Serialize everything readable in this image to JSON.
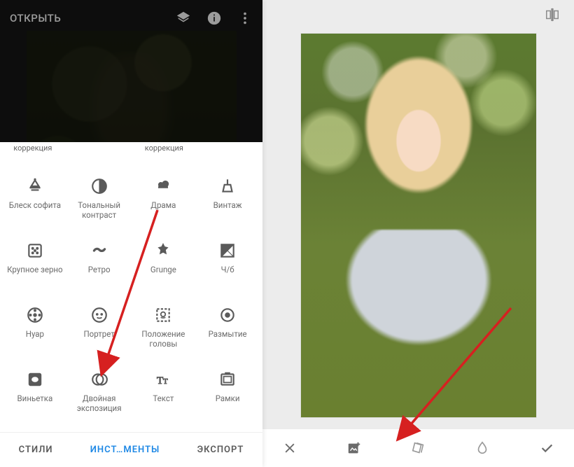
{
  "left": {
    "open_label": "ОТКРЫТЬ",
    "peek": [
      "коррекция",
      "",
      "коррекция",
      ""
    ],
    "tools": [
      {
        "id": "glamour-glow",
        "label": "Блеск софита"
      },
      {
        "id": "tonal-contrast",
        "label": "Тональный контраст"
      },
      {
        "id": "drama",
        "label": "Драма"
      },
      {
        "id": "vintage",
        "label": "Винтаж"
      },
      {
        "id": "grainy-film",
        "label": "Крупное зерно"
      },
      {
        "id": "retrolux",
        "label": "Ретро"
      },
      {
        "id": "grunge",
        "label": "Grunge"
      },
      {
        "id": "bw",
        "label": "Ч/б"
      },
      {
        "id": "noir",
        "label": "Нуар"
      },
      {
        "id": "portrait",
        "label": "Портрет"
      },
      {
        "id": "head-pose",
        "label": "Положение головы"
      },
      {
        "id": "blur",
        "label": "Размытие"
      },
      {
        "id": "vignette",
        "label": "Виньетка"
      },
      {
        "id": "double-exposure",
        "label": "Двойная экспозиция"
      },
      {
        "id": "text",
        "label": "Текст"
      },
      {
        "id": "frames",
        "label": "Рамки"
      }
    ],
    "tabs": {
      "styles": "СТИЛИ",
      "tools": "ИНСТ…МЕНТЫ",
      "export": "ЭКСПОРТ"
    }
  },
  "icons": {
    "layers": "layers-icon",
    "info": "info-icon",
    "more": "more-vert-icon",
    "compare": "compare-icon",
    "close": "close-icon",
    "add_image": "add-image-icon",
    "style": "style-icon",
    "opacity": "opacity-icon",
    "apply": "check-icon"
  }
}
